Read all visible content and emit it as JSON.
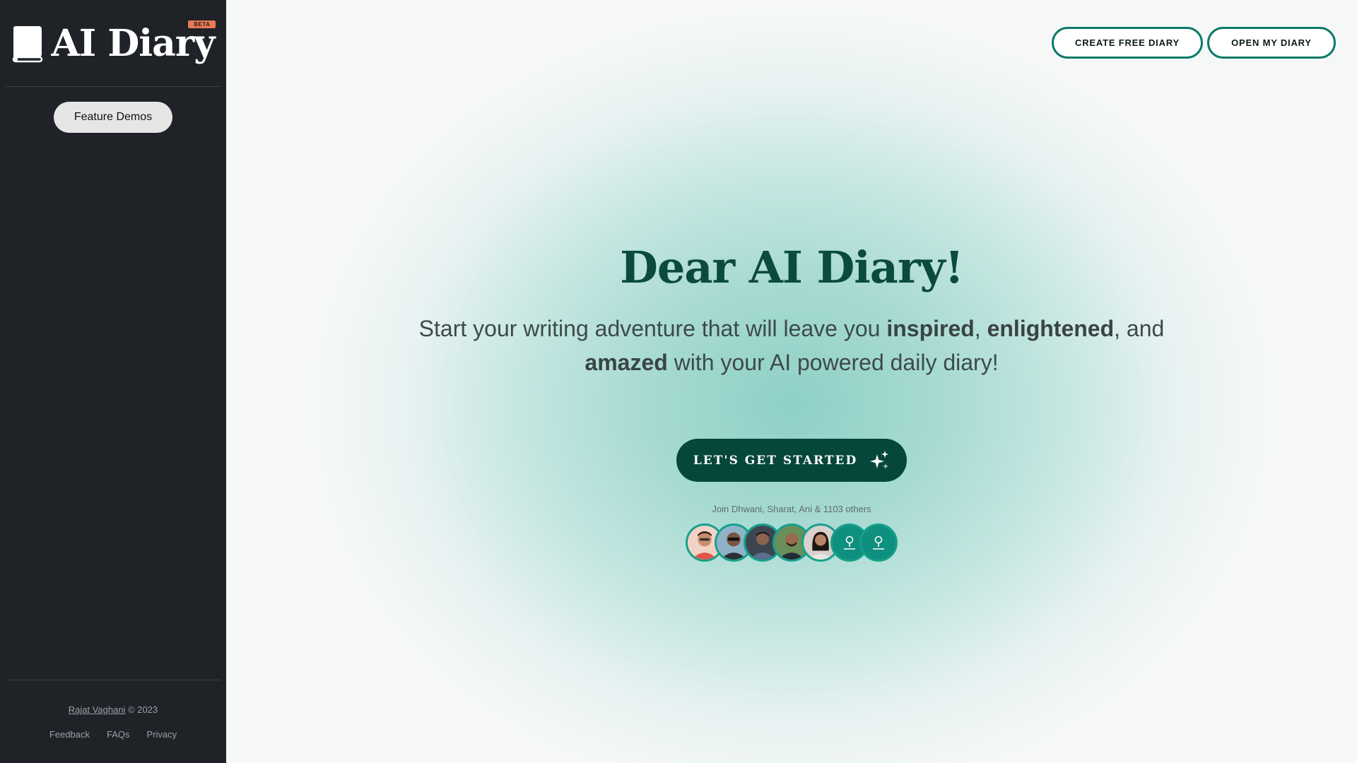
{
  "sidebar": {
    "logo_text": "AI Diary",
    "beta_badge": "BETA",
    "feature_demos": "Feature Demos",
    "footer": {
      "author": "Rajat Vaghani",
      "copyright": "© 2023",
      "links": [
        "Feedback",
        "FAQs",
        "Privacy"
      ]
    }
  },
  "header": {
    "create_free_diary": "CREATE FREE DIARY",
    "open_my_diary": "OPEN MY DIARY"
  },
  "hero": {
    "title": "Dear AI Diary!",
    "sub_part1": "Start your writing adventure that will leave you ",
    "sub_inspired": "inspired",
    "sub_comma1": ", ",
    "sub_enlightened": "enlightened",
    "sub_and": ", and",
    "sub_amazed": "amazed",
    "sub_part2": " with your AI powered daily diary!",
    "cta_label": "LET'S GET STARTED",
    "join_text": "Join Dhwani, Sharat, Ani & 1103 others"
  },
  "colors": {
    "sidebar_bg": "#1f2328",
    "accent": "#0b7a6a",
    "cta_bg": "#06473c",
    "title": "#0b4b3f",
    "beta": "#e77b55"
  },
  "icons": {
    "logo": "book-icon",
    "cta": "sparkle-icon",
    "placeholder_avatar": "user-icon"
  }
}
